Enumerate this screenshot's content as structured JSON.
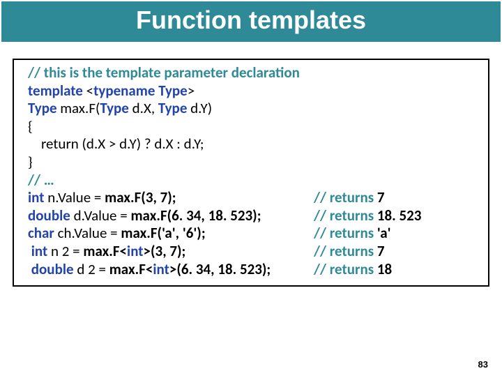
{
  "title": "Function templates",
  "comment1": "// this is the template parameter declaration",
  "kw_template": "template",
  "lt": " <",
  "kw_typename": "typename",
  "sp_type_gt": " Type",
  "gt": ">",
  "type1": "Type",
  "fn_open": " max.F(",
  "type2": "Type",
  "dx": " d.X, ",
  "type3": "Type",
  "dy_close": " d.Y)",
  "brace_open": "{",
  "return_line": "    return (d.X > d.Y) ? d.X : d.Y;",
  "brace_close": "}",
  "comment2": "// …",
  "kw_int": "int",
  "nval": " n.Value = ",
  "call1": "max.F(3, 7);",
  "ret1_pre": "// returns ",
  "ret1_val": "7",
  "kw_double": "double",
  "dval": " d.Value = ",
  "call2": "max.F(6. 34, 18. 523);",
  "ret2_pre": "// returns ",
  "ret2_val": "18. 523",
  "kw_char": "char",
  "cval": " ch.Value = ",
  "call3": "max.F('a', '6');",
  "ret3_pre": "// returns ",
  "ret3_val": "'a'",
  "sp1": " ",
  "kw_int2": "int",
  "n2": " n 2 = ",
  "call4a": "max.F<",
  "call4b": "int",
  "call4c": ">(3, 7);",
  "ret4_pre": "// returns ",
  "ret4_val": "7",
  "sp2": " ",
  "kw_double2": "double",
  "d2": " d 2 = ",
  "call5a": "max.F<",
  "call5b": "int",
  "call5c": ">(6. 34, 18. 523);",
  "ret5_pre": "// returns ",
  "ret5_val": "18",
  "page": "83"
}
